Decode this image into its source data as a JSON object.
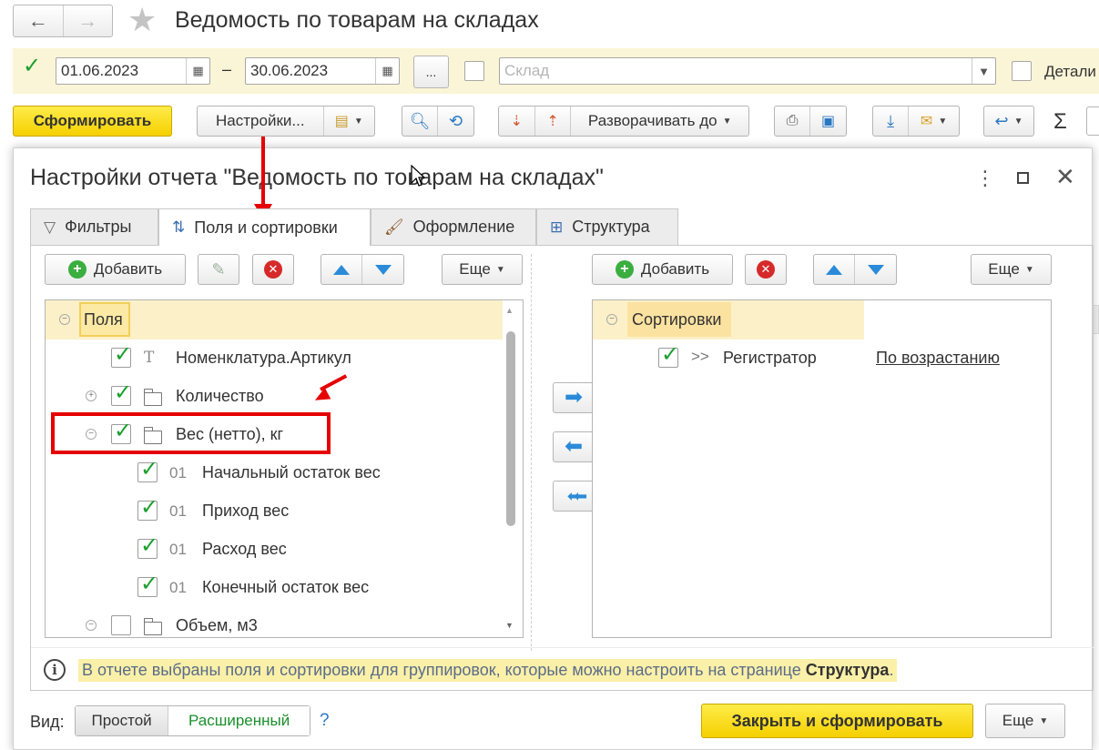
{
  "window": {
    "title": "Ведомость по товарам на складах",
    "back_icon": "←",
    "forward_icon": "→",
    "star_icon": "★"
  },
  "filters": {
    "date_from": "01.06.2023",
    "date_to": "30.06.2023",
    "dash": "–",
    "more": "...",
    "warehouse_placeholder": "Склад",
    "detail_label": "Детали"
  },
  "toolbar": {
    "generate": "Сформировать",
    "settings": "Настройки...",
    "expand_to": "Разворачивать до",
    "sigma": "Σ"
  },
  "dialog": {
    "title": "Настройки отчета \"Ведомость по товарам на складах\"",
    "tabs": [
      {
        "label": "Фильтры",
        "icon": "filter-icon"
      },
      {
        "label": "Поля и сортировки",
        "icon": "fields-icon"
      },
      {
        "label": "Оформление",
        "icon": "brush-icon"
      },
      {
        "label": "Структура",
        "icon": "structure-icon"
      }
    ],
    "left": {
      "add": "Добавить",
      "more": "Еще",
      "rows": [
        {
          "label": "Поля",
          "checked": false,
          "icon": "none",
          "prefix": ""
        },
        {
          "label": "Номенклатура.Артикул",
          "checked": true,
          "icon": "text-icon",
          "prefix": "T"
        },
        {
          "label": "Количество",
          "checked": true,
          "icon": "folder-icon",
          "prefix": ""
        },
        {
          "label": "Вес (нетто), кг",
          "checked": true,
          "icon": "folder-icon",
          "prefix": ""
        },
        {
          "label": "Начальный остаток вес",
          "checked": true,
          "icon": "number-icon",
          "prefix": "01"
        },
        {
          "label": "Приход вес",
          "checked": true,
          "icon": "number-icon",
          "prefix": "01"
        },
        {
          "label": "Расход вес",
          "checked": true,
          "icon": "number-icon",
          "prefix": "01"
        },
        {
          "label": "Конечный остаток вес",
          "checked": true,
          "icon": "number-icon",
          "prefix": "01"
        },
        {
          "label": "Объем, м3",
          "checked": false,
          "icon": "folder-icon",
          "prefix": ""
        }
      ]
    },
    "right": {
      "add": "Добавить",
      "more": "Еще",
      "header": "Сортировки",
      "rows": [
        {
          "label": "Регистратор",
          "direction": "По возрастанию",
          "checked": true,
          "prefix": ">>"
        }
      ]
    },
    "info": {
      "text": "В отчете выбраны поля и сортировки для группировок, которые можно настроить на странице ",
      "link": "Структура",
      "suffix": "."
    },
    "footer": {
      "view_label": "Вид:",
      "simple": "Простой",
      "advanced": "Расширенный",
      "help": "?",
      "close_generate": "Закрыть и сформировать",
      "more": "Еще"
    }
  },
  "colors": {
    "accent_yellow": "#f5d000",
    "filter_bg": "#fbf5d7",
    "check_green": "#1a9f2c",
    "annotation_red": "#e60000"
  }
}
